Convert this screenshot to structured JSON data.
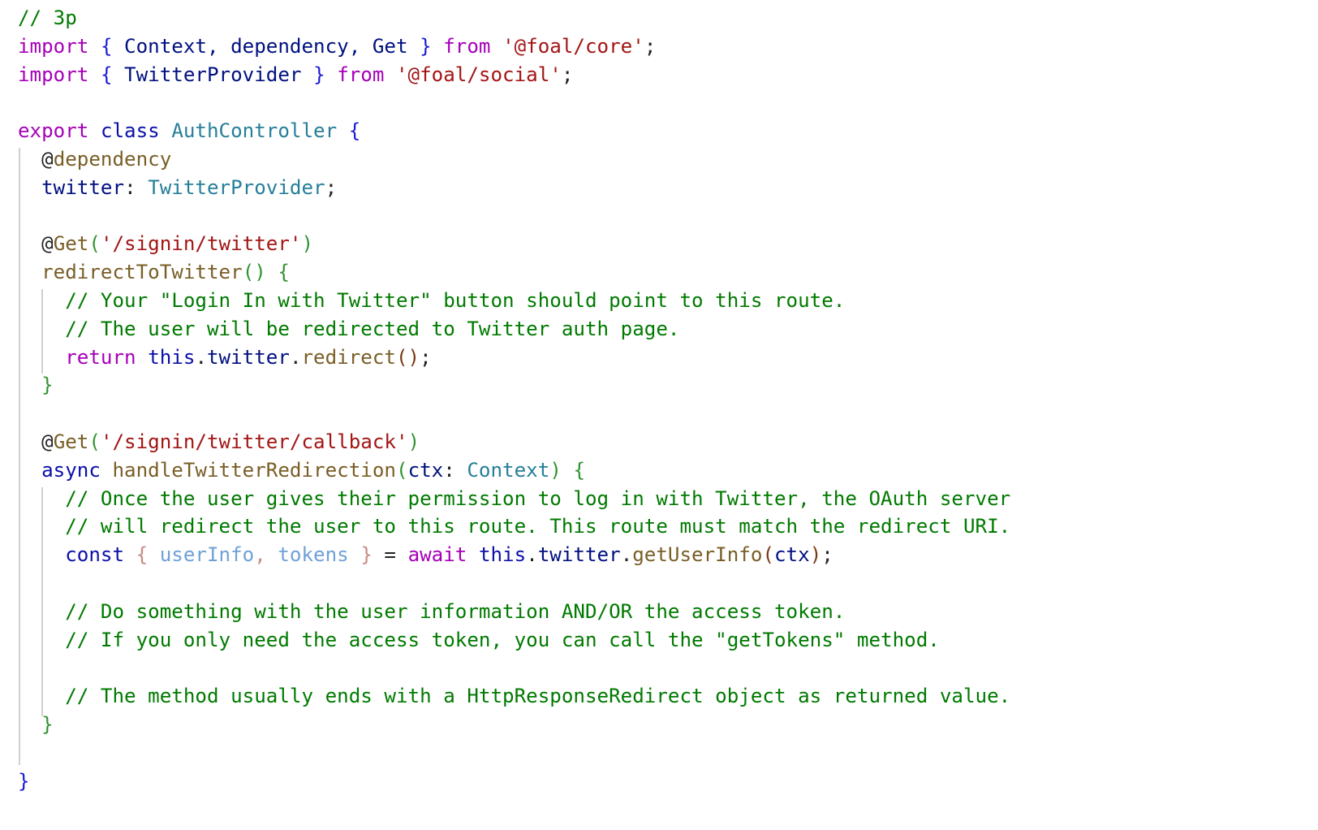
{
  "code_lines": [
    [
      {
        "t": "// 3p",
        "c": "comment"
      }
    ],
    [
      {
        "t": "import",
        "c": "keyword"
      },
      {
        "t": " ",
        "c": "plain"
      },
      {
        "t": "{",
        "c": "brace"
      },
      {
        "t": " Context, dependency, Get ",
        "c": "variable"
      },
      {
        "t": "}",
        "c": "brace"
      },
      {
        "t": " ",
        "c": "plain"
      },
      {
        "t": "from",
        "c": "keyword"
      },
      {
        "t": " ",
        "c": "plain"
      },
      {
        "t": "'@foal/core'",
        "c": "string"
      },
      {
        "t": ";",
        "c": "punct"
      }
    ],
    [
      {
        "t": "import",
        "c": "keyword"
      },
      {
        "t": " ",
        "c": "plain"
      },
      {
        "t": "{",
        "c": "brace"
      },
      {
        "t": " TwitterProvider ",
        "c": "variable"
      },
      {
        "t": "}",
        "c": "brace"
      },
      {
        "t": " ",
        "c": "plain"
      },
      {
        "t": "from",
        "c": "keyword"
      },
      {
        "t": " ",
        "c": "plain"
      },
      {
        "t": "'@foal/social'",
        "c": "string"
      },
      {
        "t": ";",
        "c": "punct"
      }
    ],
    [],
    [
      {
        "t": "export",
        "c": "keyword"
      },
      {
        "t": " ",
        "c": "plain"
      },
      {
        "t": "class",
        "c": "storage"
      },
      {
        "t": " ",
        "c": "plain"
      },
      {
        "t": "AuthController",
        "c": "type"
      },
      {
        "t": " ",
        "c": "plain"
      },
      {
        "t": "{",
        "c": "brace"
      }
    ],
    [
      {
        "t": "  ",
        "c": "plain"
      },
      {
        "t": "@",
        "c": "decorator"
      },
      {
        "t": "dependency",
        "c": "function"
      }
    ],
    [
      {
        "t": "  ",
        "c": "plain"
      },
      {
        "t": "twitter",
        "c": "variable"
      },
      {
        "t": ": ",
        "c": "punct"
      },
      {
        "t": "TwitterProvider",
        "c": "type"
      },
      {
        "t": ";",
        "c": "punct"
      }
    ],
    [],
    [
      {
        "t": "  ",
        "c": "plain"
      },
      {
        "t": "@",
        "c": "decorator"
      },
      {
        "t": "Get",
        "c": "function"
      },
      {
        "t": "(",
        "c": "brace2"
      },
      {
        "t": "'/signin/twitter'",
        "c": "string"
      },
      {
        "t": ")",
        "c": "brace2"
      }
    ],
    [
      {
        "t": "  ",
        "c": "plain"
      },
      {
        "t": "redirectToTwitter",
        "c": "function"
      },
      {
        "t": "()",
        "c": "brace2"
      },
      {
        "t": " ",
        "c": "plain"
      },
      {
        "t": "{",
        "c": "brace2"
      }
    ],
    [
      {
        "t": "    ",
        "c": "plain"
      },
      {
        "t": "// Your \"Login In with Twitter\" button should point to this route.",
        "c": "comment"
      }
    ],
    [
      {
        "t": "    ",
        "c": "plain"
      },
      {
        "t": "// The user will be redirected to Twitter auth page.",
        "c": "comment"
      }
    ],
    [
      {
        "t": "    ",
        "c": "plain"
      },
      {
        "t": "return",
        "c": "keyword"
      },
      {
        "t": " ",
        "c": "plain"
      },
      {
        "t": "this",
        "c": "storage"
      },
      {
        "t": ".",
        "c": "punct"
      },
      {
        "t": "twitter",
        "c": "variable"
      },
      {
        "t": ".",
        "c": "punct"
      },
      {
        "t": "redirect",
        "c": "function"
      },
      {
        "t": "()",
        "c": "brace3"
      },
      {
        "t": ";",
        "c": "punct"
      }
    ],
    [
      {
        "t": "  ",
        "c": "plain"
      },
      {
        "t": "}",
        "c": "brace2"
      }
    ],
    [],
    [
      {
        "t": "  ",
        "c": "plain"
      },
      {
        "t": "@",
        "c": "decorator"
      },
      {
        "t": "Get",
        "c": "function"
      },
      {
        "t": "(",
        "c": "brace2"
      },
      {
        "t": "'/signin/twitter/callback'",
        "c": "string"
      },
      {
        "t": ")",
        "c": "brace2"
      }
    ],
    [
      {
        "t": "  ",
        "c": "plain"
      },
      {
        "t": "async",
        "c": "storage"
      },
      {
        "t": " ",
        "c": "plain"
      },
      {
        "t": "handleTwitterRedirection",
        "c": "function"
      },
      {
        "t": "(",
        "c": "brace2"
      },
      {
        "t": "ctx",
        "c": "variable"
      },
      {
        "t": ": ",
        "c": "punct"
      },
      {
        "t": "Context",
        "c": "type"
      },
      {
        "t": ")",
        "c": "brace2"
      },
      {
        "t": " ",
        "c": "plain"
      },
      {
        "t": "{",
        "c": "brace2"
      }
    ],
    [
      {
        "t": "    ",
        "c": "plain"
      },
      {
        "t": "// Once the user gives their permission to log in with Twitter, the OAuth server",
        "c": "comment"
      }
    ],
    [
      {
        "t": "    ",
        "c": "plain"
      },
      {
        "t": "// will redirect the user to this route. This route must match the redirect URI.",
        "c": "comment"
      }
    ],
    [
      {
        "t": "    ",
        "c": "plain"
      },
      {
        "t": "const",
        "c": "storage"
      },
      {
        "t": " ",
        "c": "plain"
      },
      {
        "t": "{",
        "c": "brace4"
      },
      {
        "t": " userInfo",
        "c": "destructure"
      },
      {
        "t": ",",
        "c": "brace4"
      },
      {
        "t": " tokens ",
        "c": "destructure"
      },
      {
        "t": "}",
        "c": "brace4"
      },
      {
        "t": " = ",
        "c": "punct"
      },
      {
        "t": "await",
        "c": "keyword"
      },
      {
        "t": " ",
        "c": "plain"
      },
      {
        "t": "this",
        "c": "storage"
      },
      {
        "t": ".",
        "c": "punct"
      },
      {
        "t": "twitter",
        "c": "variable"
      },
      {
        "t": ".",
        "c": "punct"
      },
      {
        "t": "getUserInfo",
        "c": "function"
      },
      {
        "t": "(",
        "c": "brace3"
      },
      {
        "t": "ctx",
        "c": "variable"
      },
      {
        "t": ")",
        "c": "brace3"
      },
      {
        "t": ";",
        "c": "punct"
      }
    ],
    [],
    [
      {
        "t": "    ",
        "c": "plain"
      },
      {
        "t": "// Do something with the user information AND/OR the access token.",
        "c": "comment"
      }
    ],
    [
      {
        "t": "    ",
        "c": "plain"
      },
      {
        "t": "// If you only need the access token, you can call the \"getTokens\" method.",
        "c": "comment"
      }
    ],
    [],
    [
      {
        "t": "    ",
        "c": "plain"
      },
      {
        "t": "// The method usually ends with a HttpResponseRedirect object as returned value.",
        "c": "comment"
      }
    ],
    [
      {
        "t": "  ",
        "c": "plain"
      },
      {
        "t": "}",
        "c": "brace2"
      }
    ],
    [],
    [
      {
        "t": "}",
        "c": "brace"
      }
    ]
  ]
}
